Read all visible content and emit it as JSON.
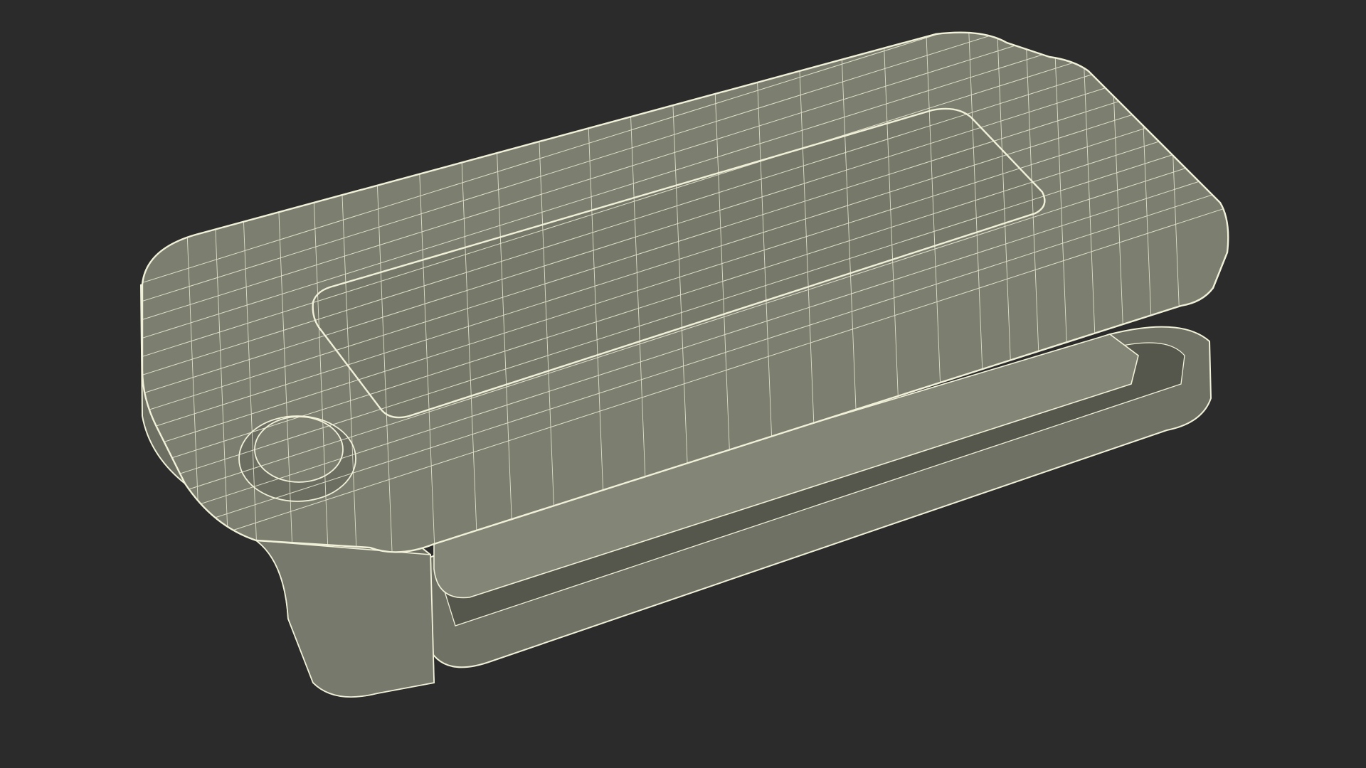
{
  "scene": {
    "background_color": "#2b2b2b",
    "surface_color": "#76786a",
    "surface_light_color": "#8a8c7d",
    "surface_dark_color": "#5c5e52",
    "wire_color": "#f1f0d8",
    "subject_icon": "wireframe-key-fob-model-icon"
  }
}
